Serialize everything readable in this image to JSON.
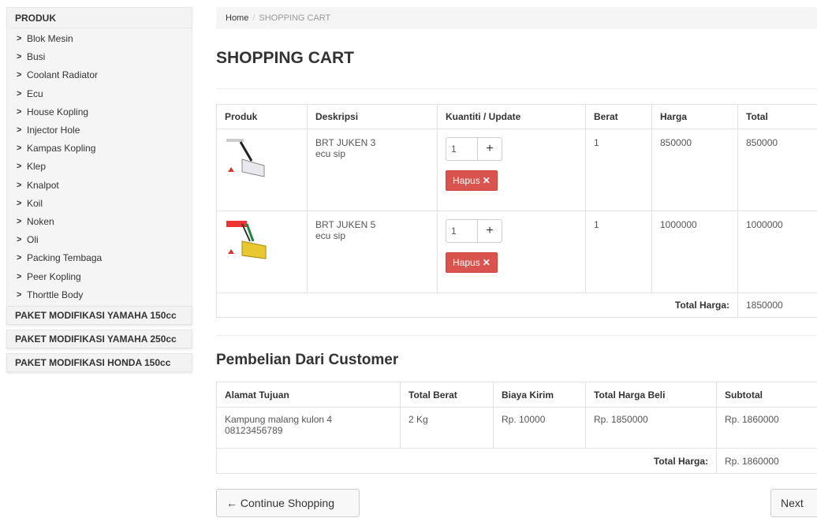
{
  "sidebar": {
    "head": "PRODUK",
    "items": [
      "Blok Mesin",
      "Busi",
      "Coolant Radiator",
      "Ecu",
      "House Kopling",
      "Injector Hole",
      "Kampas Kopling",
      "Klep",
      "Knalpot",
      "Koil",
      "Noken",
      "Oli",
      "Packing Tembaga",
      "Peer Kopling",
      "Thorttle Body"
    ],
    "categories": [
      "PAKET MODIFIKASI YAMAHA 150cc",
      "PAKET MODIFIKASI YAMAHA 250cc",
      "PAKET MODIFIKASI HONDA 150cc"
    ]
  },
  "breadcrumb": {
    "home": "Home",
    "sep": "/",
    "current": "SHOPPING CART"
  },
  "title": "SHOPPING CART",
  "cart": {
    "headers": [
      "Produk",
      "Deskripsi",
      "Kuantiti / Update",
      "Berat",
      "Harga",
      "Total"
    ],
    "rows": [
      {
        "name": "BRT JUKEN 3",
        "desc": "ecu sip",
        "qty": "1",
        "plus": "+",
        "delete": "Hapus",
        "delete_icon": "✕",
        "berat": "1",
        "harga": "850000",
        "total": "850000"
      },
      {
        "name": "BRT JUKEN 5",
        "desc": "ecu sip",
        "qty": "1",
        "plus": "+",
        "delete": "Hapus",
        "delete_icon": "✕",
        "berat": "1",
        "harga": "1000000",
        "total": "1000000"
      }
    ],
    "total_label": "Total Harga:",
    "total_value": "1850000"
  },
  "order_title": "Pembelian Dari Customer",
  "order": {
    "headers": [
      "Alamat Tujuan",
      "Total Berat",
      "Biaya Kirim",
      "Total Harga Beli",
      "Subtotal"
    ],
    "row": {
      "alamat": "Kampung malang kulon 4",
      "phone": "08123456789",
      "berat": "2 Kg",
      "biaya": "Rp. 10000",
      "harga_beli": "Rp. 1850000",
      "subtotal": "Rp. 1860000"
    },
    "total_label": "Total Harga:",
    "total_value": "Rp. 1860000"
  },
  "buttons": {
    "continue": "← Continue Shopping",
    "next": "Next ➔"
  },
  "colors": {
    "danger": "#d9534f",
    "panel": "#f5f5f5"
  }
}
